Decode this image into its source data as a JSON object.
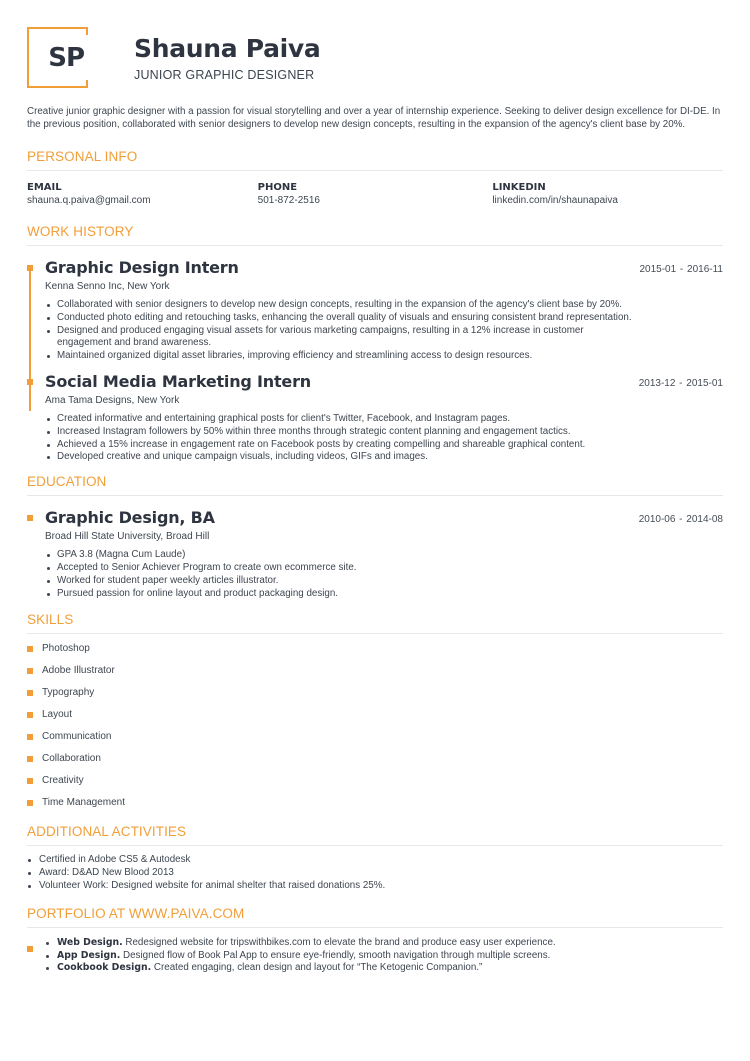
{
  "colors": {
    "accent": "#f29e38",
    "text": "#3e4650",
    "heading": "#2e3440"
  },
  "header": {
    "initials": "SP",
    "name": "Shauna Paiva",
    "title": "JUNIOR GRAPHIC DESIGNER"
  },
  "summary": "Creative junior graphic designer with a passion for visual storytelling and over a year of internship experience. Seeking to deliver design excellence for DI-DE. In the previous position, collaborated with senior designers to develop new design concepts, resulting in the expansion of the agency's client base by 20%.",
  "personal_info": {
    "title": "PERSONAL INFO",
    "fields": [
      {
        "label": "EMAIL",
        "value": "shauna.q.paiva@gmail.com"
      },
      {
        "label": "PHONE",
        "value": "501-872-2516"
      },
      {
        "label": "LINKEDIN",
        "value": "linkedin.com/in/shaunapaiva"
      }
    ]
  },
  "work_history": {
    "title": "WORK HISTORY",
    "entries": [
      {
        "title": "Graphic Design Intern",
        "org": "Kenna Senno Inc, New York",
        "date": "2015-01  - 2016-11",
        "bullets": [
          "Collaborated with senior designers to develop new design concepts, resulting in the expansion of the agency's client base by 20%.",
          "Conducted photo editing and retouching tasks, enhancing the overall quality of visuals and ensuring consistent brand representation.",
          "Designed and produced engaging visual assets for various marketing campaigns, resulting in a 12% increase in customer engagement and brand awareness.",
          "Maintained organized digital asset libraries, improving efficiency and streamlining access to design resources."
        ]
      },
      {
        "title": "Social Media Marketing Intern",
        "org": "Ama Tama Designs, New York",
        "date": "2013-12  - 2015-01",
        "bullets": [
          "Created informative and entertaining graphical posts for client's Twitter, Facebook, and Instagram pages.",
          "Increased Instagram followers by 50% within three months through strategic content planning and engagement tactics.",
          "Achieved a 15% increase in engagement rate on Facebook posts by creating compelling and shareable graphical content.",
          "Developed creative and unique campaign visuals, including videos, GIFs and images."
        ]
      }
    ]
  },
  "education": {
    "title": "EDUCATION",
    "entries": [
      {
        "title": "Graphic Design, BA",
        "org": "Broad Hill State University, Broad Hill",
        "date": "2010-06  - 2014-08",
        "bullets": [
          "GPA 3.8 (Magna Cum Laude)",
          "Accepted to Senior Achiever Program to create own ecommerce site.",
          "Worked for student paper weekly articles illustrator.",
          "Pursued passion for online layout and product packaging design."
        ]
      }
    ]
  },
  "skills": {
    "title": "SKILLS",
    "items": [
      "Photoshop",
      "Adobe Illustrator",
      "Typography",
      "Layout",
      "Communication",
      "Collaboration",
      "Creativity",
      "Time Management"
    ]
  },
  "additional": {
    "title": "ADDITIONAL ACTIVITIES",
    "items": [
      "Certified in Adobe CS5 & Autodesk",
      "Award: D&AD New Blood 2013",
      "Volunteer Work: Designed website for animal shelter that raised donations 25%."
    ]
  },
  "portfolio": {
    "title": "PORTFOLIO AT WWW.PAIVA.COM",
    "items": [
      {
        "bold": "Web Design.",
        "text": " Redesigned website for tripswithbikes.com to elevate the brand and produce easy user experience."
      },
      {
        "bold": "App Design.",
        "text": " Designed flow of Book Pal App to ensure eye-friendly, smooth navigation through multiple screens."
      },
      {
        "bold": "Cookbook Design.",
        "text": " Created engaging, clean design and layout for “The Ketogenic Companion.”"
      }
    ]
  }
}
